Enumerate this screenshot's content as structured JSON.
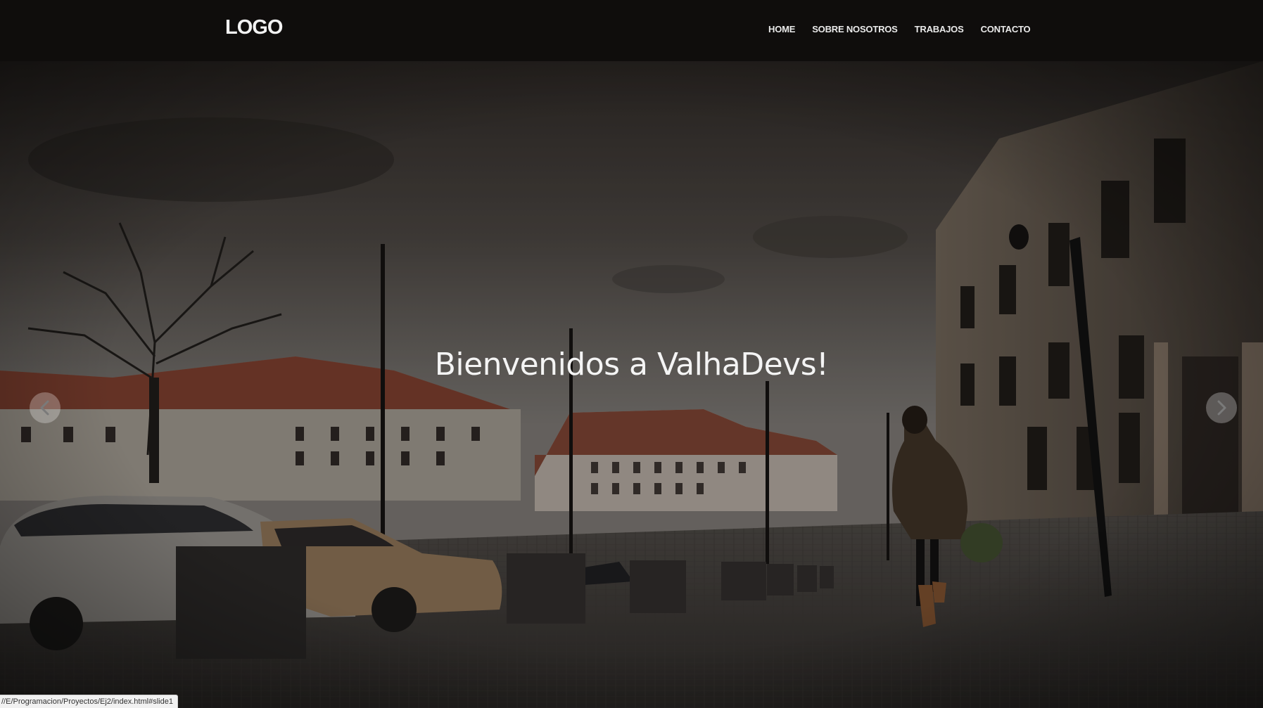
{
  "navbar": {
    "logo": "LOGO",
    "links": [
      {
        "label": "HOME"
      },
      {
        "label": "SOBRE NOSOTROS"
      },
      {
        "label": "TRABAJOS"
      },
      {
        "label": "CONTACTO"
      }
    ]
  },
  "hero": {
    "title": "Bienvenidos a ValhaDevs!",
    "prev_icon": "chevron-left-icon",
    "next_icon": "chevron-right-icon"
  },
  "status_bar": {
    "url": "//E/Programacion/Proyectos/Ej2/index.html#slide1"
  },
  "colors": {
    "navbar_bg": "#0f0d0c",
    "nav_text": "#eaeaea",
    "hero_text": "#f4f4f4"
  }
}
